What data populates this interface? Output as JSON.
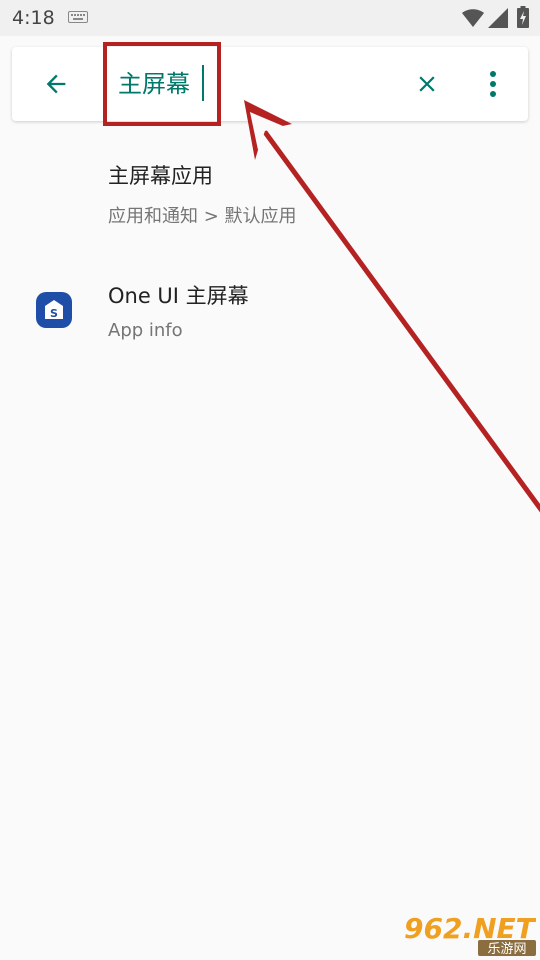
{
  "status_bar": {
    "time": "4:18",
    "icons": [
      "keyboard-icon",
      "wifi-icon",
      "signal-icon",
      "battery-icon"
    ]
  },
  "search": {
    "query": "主屏幕",
    "icons": [
      "back-arrow-icon",
      "clear-icon",
      "more-vert-icon"
    ]
  },
  "results": [
    {
      "title": "主屏幕应用",
      "subtitle": "应用和通知 > 默认应用"
    },
    {
      "title": "One UI 主屏幕",
      "subtitle": "App info",
      "icon": "one-ui-home-icon"
    }
  ],
  "watermark": {
    "brand": "962.NET",
    "sub": "乐游网"
  },
  "colors": {
    "accent": "#00796b",
    "annotation": "#b52222",
    "app_icon": "#1e4ea8",
    "background": "#fafafa"
  }
}
